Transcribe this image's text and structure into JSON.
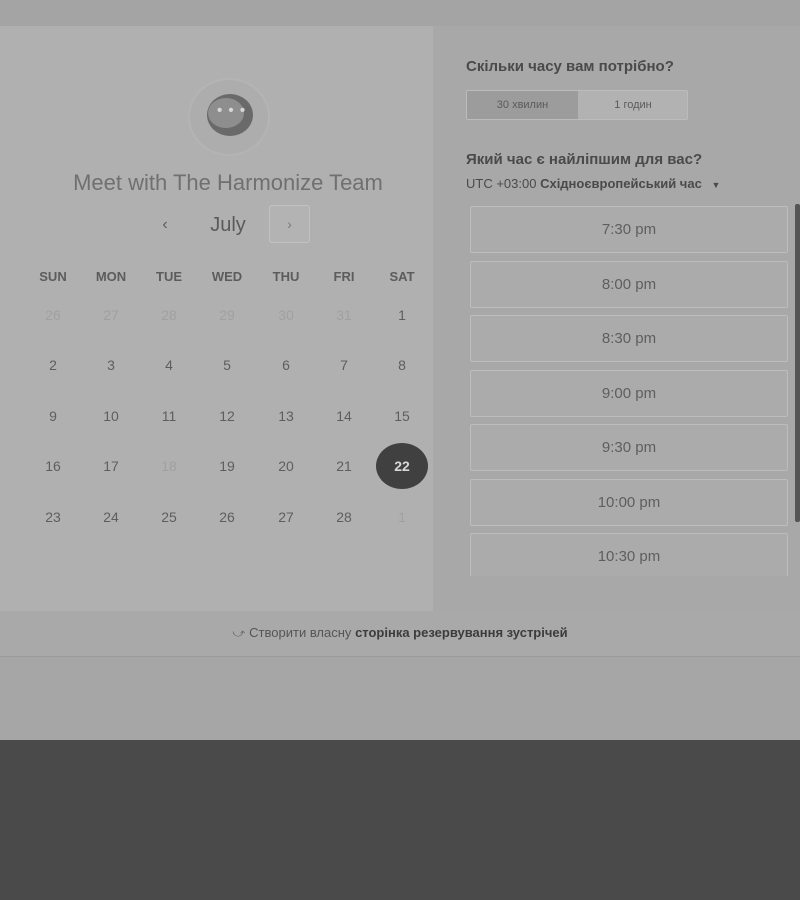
{
  "event": {
    "title": "Meet with The Harmonize Team"
  },
  "calendar": {
    "month": "July",
    "prev_icon": "chevron-left-icon",
    "next_icon": "chevron-right-icon",
    "weekdays": [
      "SUN",
      "MON",
      "TUE",
      "WED",
      "THU",
      "FRI",
      "SAT"
    ],
    "weeks": [
      [
        "26",
        "27",
        "28",
        "29",
        "30",
        "31",
        "1"
      ],
      [
        "2",
        "3",
        "4",
        "5",
        "6",
        "7",
        "8"
      ],
      [
        "9",
        "10",
        "11",
        "12",
        "13",
        "14",
        "15"
      ],
      [
        "16",
        "17",
        "18",
        "19",
        "20",
        "21",
        "22"
      ],
      [
        "23",
        "24",
        "25",
        "26",
        "27",
        "28",
        "1"
      ]
    ],
    "selected_day": "22"
  },
  "duration": {
    "question": "Скільки часу вам потрібно?",
    "options": [
      "30 хвилин",
      "1 годин"
    ],
    "selected": "30 хвилин"
  },
  "time": {
    "question": "Який час є найліпшим для вас?",
    "timezone_offset": "UTC +03:00",
    "timezone_name": "Східноєвропейський час",
    "slots": [
      "7:30 pm",
      "8:00 pm",
      "8:30 pm",
      "9:00 pm",
      "9:30 pm",
      "10:00 pm",
      "10:30 pm"
    ]
  },
  "footer": {
    "prefix": "Створити власну",
    "link": "сторінка резервування зустрічей"
  }
}
